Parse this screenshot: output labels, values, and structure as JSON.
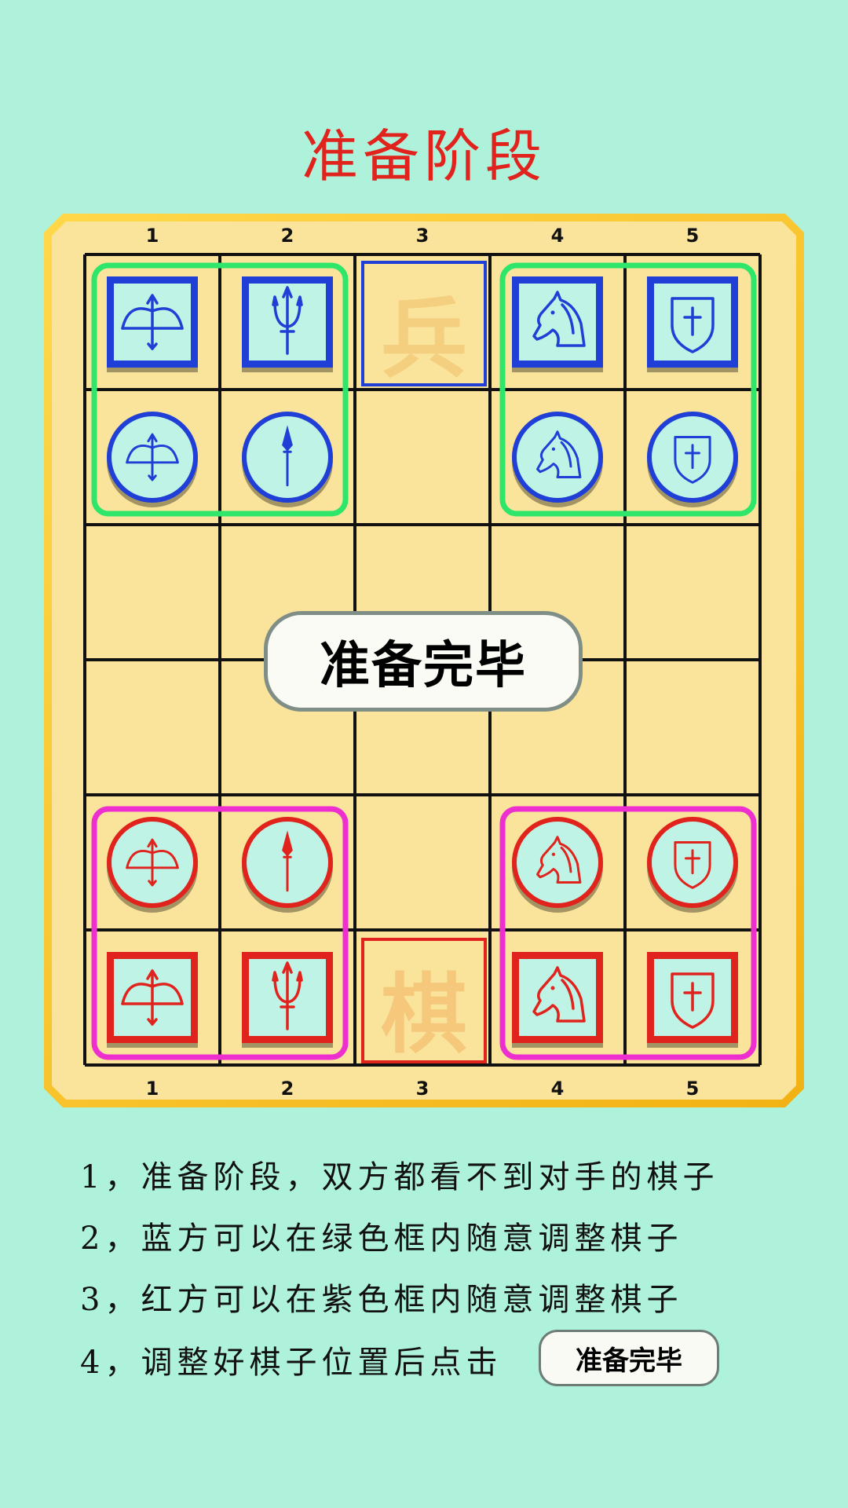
{
  "title": "准备阶段",
  "board": {
    "column_labels": [
      "1",
      "2",
      "3",
      "4",
      "5"
    ],
    "rows": 6,
    "cols": 5,
    "blue_reserve_char": "兵",
    "red_reserve_char": "棋",
    "blue_zone_color": "#2ee66a",
    "red_zone_color": "#ee2fd0",
    "blue_color": "#1f3fd6",
    "red_color": "#e0231c",
    "pieces": [
      {
        "side": "blue",
        "shape": "square",
        "icon": "bow-icon",
        "row": 0,
        "col": 0
      },
      {
        "side": "blue",
        "shape": "square",
        "icon": "trident-icon",
        "row": 0,
        "col": 1
      },
      {
        "side": "blue",
        "shape": "square",
        "icon": "horse-icon",
        "row": 0,
        "col": 3
      },
      {
        "side": "blue",
        "shape": "square",
        "icon": "shield-icon",
        "row": 0,
        "col": 4
      },
      {
        "side": "blue",
        "shape": "circle",
        "icon": "bow-icon",
        "row": 1,
        "col": 0
      },
      {
        "side": "blue",
        "shape": "circle",
        "icon": "spear-icon",
        "row": 1,
        "col": 1
      },
      {
        "side": "blue",
        "shape": "circle",
        "icon": "horse-icon",
        "row": 1,
        "col": 3
      },
      {
        "side": "blue",
        "shape": "circle",
        "icon": "shield-icon",
        "row": 1,
        "col": 4
      },
      {
        "side": "red",
        "shape": "circle",
        "icon": "bow-icon",
        "row": 4,
        "col": 0
      },
      {
        "side": "red",
        "shape": "circle",
        "icon": "spear-icon",
        "row": 4,
        "col": 1
      },
      {
        "side": "red",
        "shape": "circle",
        "icon": "horse-icon",
        "row": 4,
        "col": 3
      },
      {
        "side": "red",
        "shape": "circle",
        "icon": "shield-icon",
        "row": 4,
        "col": 4
      },
      {
        "side": "red",
        "shape": "square",
        "icon": "bow-icon",
        "row": 5,
        "col": 0
      },
      {
        "side": "red",
        "shape": "square",
        "icon": "trident-icon",
        "row": 5,
        "col": 1
      },
      {
        "side": "red",
        "shape": "square",
        "icon": "horse-icon",
        "row": 5,
        "col": 3
      },
      {
        "side": "red",
        "shape": "square",
        "icon": "shield-icon",
        "row": 5,
        "col": 4
      }
    ]
  },
  "ready_button_label": "准备完毕",
  "instructions": [
    "1，准备阶段，双方都看不到对手的棋子",
    "2，蓝方可以在绿色框内随意调整棋子",
    "3，红方可以在紫色框内随意调整棋子",
    "4，调整好棋子位置后点击"
  ],
  "instruction_button_label": "准备完毕"
}
